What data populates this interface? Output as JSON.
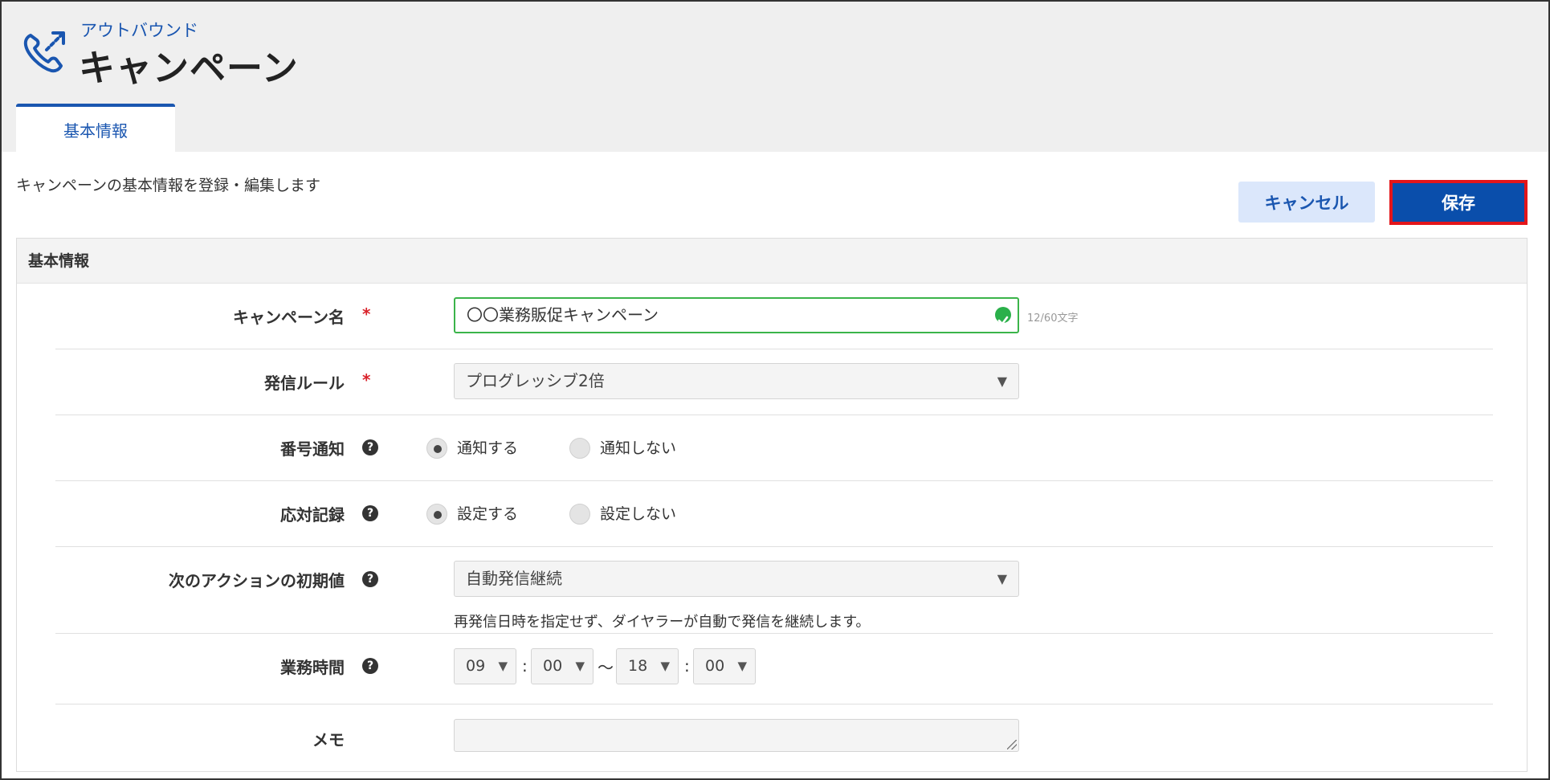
{
  "header": {
    "subtitle": "アウトバウンド",
    "title": "キャンペーン",
    "icon": "phone-outbound-icon"
  },
  "tabs": [
    {
      "label": "基本情報",
      "active": true
    }
  ],
  "page_description": "キャンペーンの基本情報を登録・編集します",
  "actions": {
    "cancel_label": "キャンセル",
    "save_label": "保存"
  },
  "panel": {
    "title": "基本情報",
    "required_mark": "*",
    "help_glyph": "?",
    "fields": {
      "campaign_name": {
        "label": "キャンペーン名",
        "value": "〇〇業務販促キャンペーン",
        "counter": "12/60文字",
        "valid": true
      },
      "dial_rule": {
        "label": "発信ルール",
        "value": "プログレッシブ2倍"
      },
      "caller_id": {
        "label": "番号通知",
        "options": [
          "通知する",
          "通知しない"
        ],
        "selected": "通知する"
      },
      "call_record": {
        "label": "応対記録",
        "options": [
          "設定する",
          "設定しない"
        ],
        "selected": "設定する"
      },
      "next_action": {
        "label": "次のアクションの初期値",
        "value": "自動発信継続",
        "hint": "再発信日時を指定せず、ダイヤラーが自動で発信を継続します。"
      },
      "business_hours": {
        "label": "業務時間",
        "start_hour": "09",
        "start_minute": "00",
        "end_hour": "18",
        "end_minute": "00",
        "time_separator": ":",
        "range_separator": "～"
      },
      "memo": {
        "label": "メモ",
        "value": ""
      }
    }
  },
  "colors": {
    "accent": "#1a56b0",
    "save_button": "#0a4eab",
    "save_highlight_border": "#e3151a",
    "valid_green": "#3bb44a",
    "required_red": "#d9222a"
  }
}
